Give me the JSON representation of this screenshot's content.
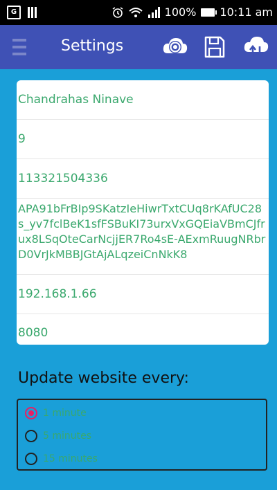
{
  "status_bar": {
    "left_icons": [
      "g-plus-icon",
      "barcode-icon"
    ],
    "right_icons": [
      "alarm-icon",
      "wifi-icon",
      "signal-icon",
      "battery-icon"
    ],
    "battery_percent": "100%",
    "time": "10:11 am"
  },
  "toolbar": {
    "title": "Settings",
    "background": "#3f51b5",
    "actions": [
      "refresh-cloud-icon",
      "save-icon",
      "cloud-sync-icon"
    ]
  },
  "settings_fields": [
    "Chandrahas Ninave",
    "9",
    "113321504336",
    "APA91bFrBIp9SKatzIeHiwrTxtCUq8rKAfUC28s_yv7fclBeK1sfFSBuKI73urxVxGQEiaVBmCJfrux8LSqOteCarNcjjER7Ro4sE-AExmRuugNRbrD0VrJkMBBJGtAjALqzeiCnNkK8",
    "192.168.1.66",
    "8080"
  ],
  "update_section": {
    "label": "Update website every:",
    "options": [
      "1 minute",
      "5 minutes",
      "15 minutes"
    ],
    "selected": "1 minute"
  },
  "colors": {
    "background": "#1a9fd8",
    "field_text": "#3aa86d",
    "radio_accent": "#e91e63"
  }
}
